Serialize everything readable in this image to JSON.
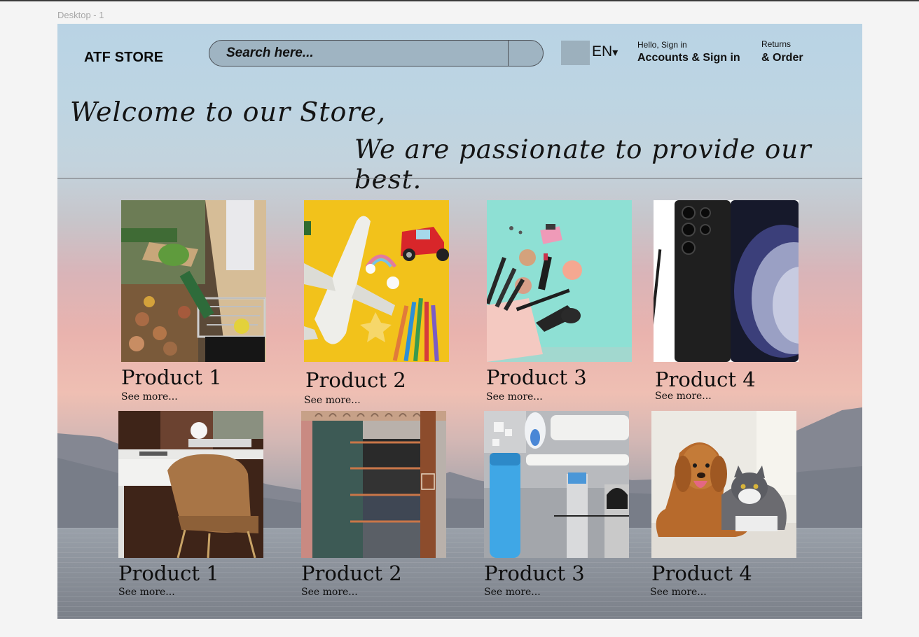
{
  "canvas": {
    "frame_label": "Desktop - 1"
  },
  "header": {
    "brand": "ATF STORE",
    "search": {
      "placeholder": "Search here...",
      "icon": "search-icon"
    },
    "language": {
      "code": "EN",
      "caret": "▾"
    },
    "account": {
      "greeting": "Hello, Sign in",
      "label": "Accounts & Sign in"
    },
    "returns": {
      "small": "Returns",
      "label": "& Order"
    }
  },
  "hero": {
    "line1": "Welcome to our Store,",
    "line2": "We are passionate to provide our best."
  },
  "products": [
    {
      "name": "Product 1",
      "more": "See more...",
      "image": "grocery-shopping-photo"
    },
    {
      "name": "Product 2",
      "more": "See more...",
      "image": "toys-and-pencils-photo"
    },
    {
      "name": "Product 3",
      "more": "See more...",
      "image": "cosmetics-photo"
    },
    {
      "name": "Product 4",
      "more": "See more...",
      "image": "smartphone-photo"
    },
    {
      "name": "Product 1",
      "more": "See more...",
      "image": "furniture-chair-photo"
    },
    {
      "name": "Product 2",
      "more": "See more...",
      "image": "clothing-rack-photo"
    },
    {
      "name": "Product 3",
      "more": "See more...",
      "image": "toiletries-photo"
    },
    {
      "name": "Product 4",
      "more": "See more...",
      "image": "pets-dog-cat-photo"
    }
  ],
  "colors": {
    "sky": "#b9d3e4",
    "sunset": "#efbfb3",
    "search_fill": "#9fb4c2",
    "swatch": "#9cb0bd"
  }
}
